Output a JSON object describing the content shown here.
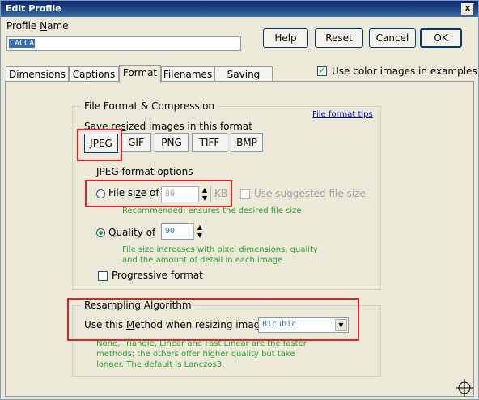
{
  "window": {
    "title": "Edit Profile",
    "close_glyph": "x"
  },
  "profile": {
    "label_pre": "Profile ",
    "label_u": "N",
    "label_post": "ame",
    "value": "CACCA"
  },
  "buttons": {
    "help": "Help",
    "reset": "Reset",
    "cancel": "Cancel",
    "ok": "OK"
  },
  "color_images": {
    "label": "Use color images in examples",
    "checked": true
  },
  "tabs": [
    {
      "label": "Dimensions",
      "active": false
    },
    {
      "label": "Captions",
      "active": false
    },
    {
      "label": "Format",
      "active": true
    },
    {
      "label": "Filenames",
      "active": false
    },
    {
      "label": "Saving Files",
      "active": false
    }
  ],
  "format_group": {
    "title": "File Format & Compression",
    "tips_link": "File format tips",
    "save_label_pre": "Save re",
    "save_label_u": "s",
    "save_label_post": "ized images in this format",
    "formats": [
      "JPEG",
      "GIF",
      "PNG",
      "TIFF",
      "BMP"
    ],
    "selected_format": "JPEG",
    "jpeg_options_title": "JPEG format options",
    "file_size": {
      "label_pre": "File si",
      "label_u": "z",
      "label_post": "e of",
      "value": "80",
      "unit": "KB",
      "selected": false
    },
    "use_suggested": {
      "label": "Use suggested file size",
      "checked": false,
      "disabled": true
    },
    "file_size_hint": "Recommended: ensures the desired file size",
    "quality": {
      "label": "Quality of",
      "value": "90",
      "selected": true
    },
    "quality_hint_1": "File size increases with pixel dimensions, quality",
    "quality_hint_2": "and the amount of detail in each image",
    "progressive": {
      "label": "Progressive format",
      "checked": false
    }
  },
  "resampling_group": {
    "title": "Resampling Algorithm",
    "method_label_pre": "Use this ",
    "method_label_u": "M",
    "method_label_post": "ethod when resizing images",
    "method_value": "Bicubic",
    "hint_1": "None, Triangle, Linear and Fast Linear are the faster",
    "hint_2": "methods; the others offer higher quality but take",
    "hint_3": "longer. The default is Lanczos3."
  },
  "colors": {
    "accent_red": "#e0202a",
    "hint_green": "#2aa22a",
    "title_blue": "#0a246a"
  }
}
